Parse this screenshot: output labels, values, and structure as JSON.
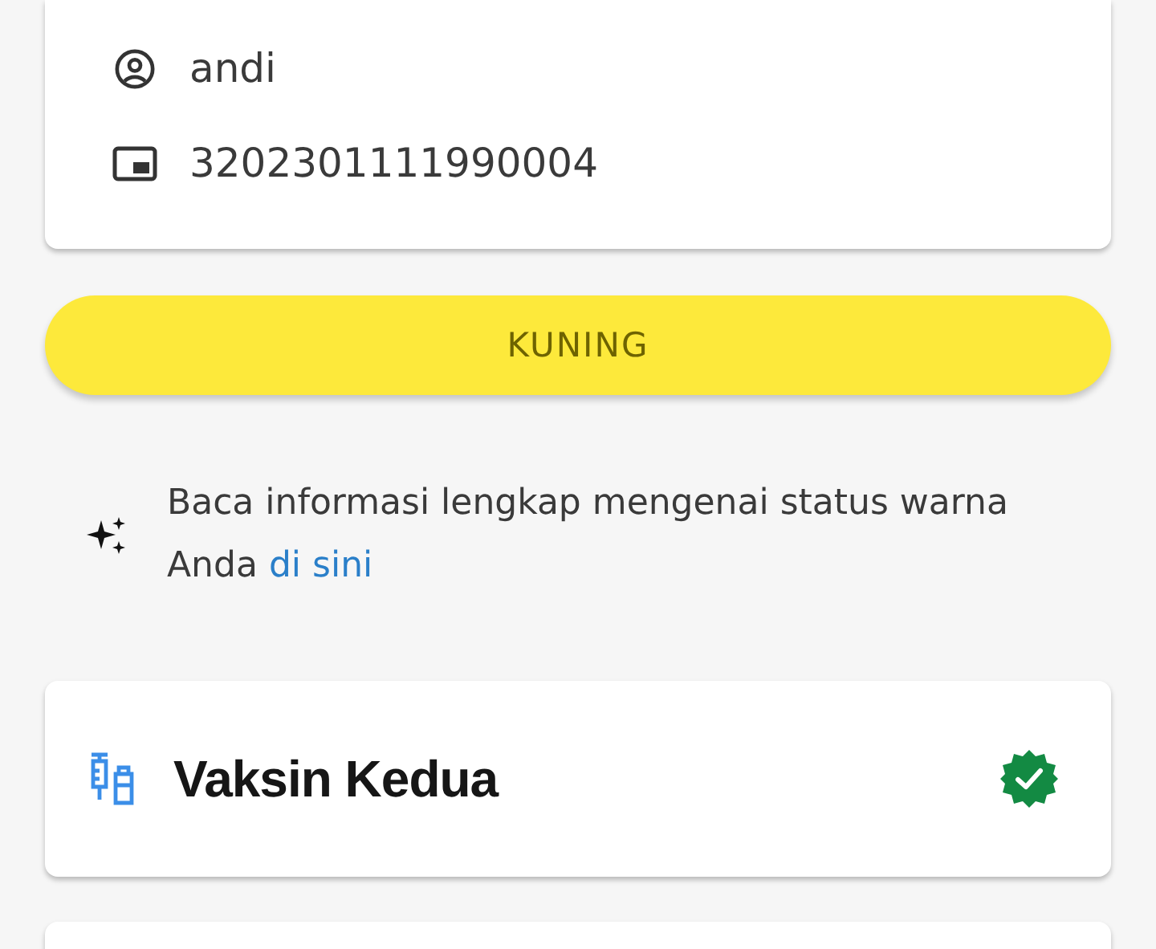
{
  "profile": {
    "name": "andi",
    "id_number": "3202301111990004"
  },
  "status": {
    "label": "KUNING",
    "color": "#fde93b"
  },
  "info": {
    "text": "Baca informasi lengkap mengenai status warna Anda",
    "link": "di sini"
  },
  "vaccine": {
    "title": "Vaksin Kedua",
    "verified": true
  }
}
